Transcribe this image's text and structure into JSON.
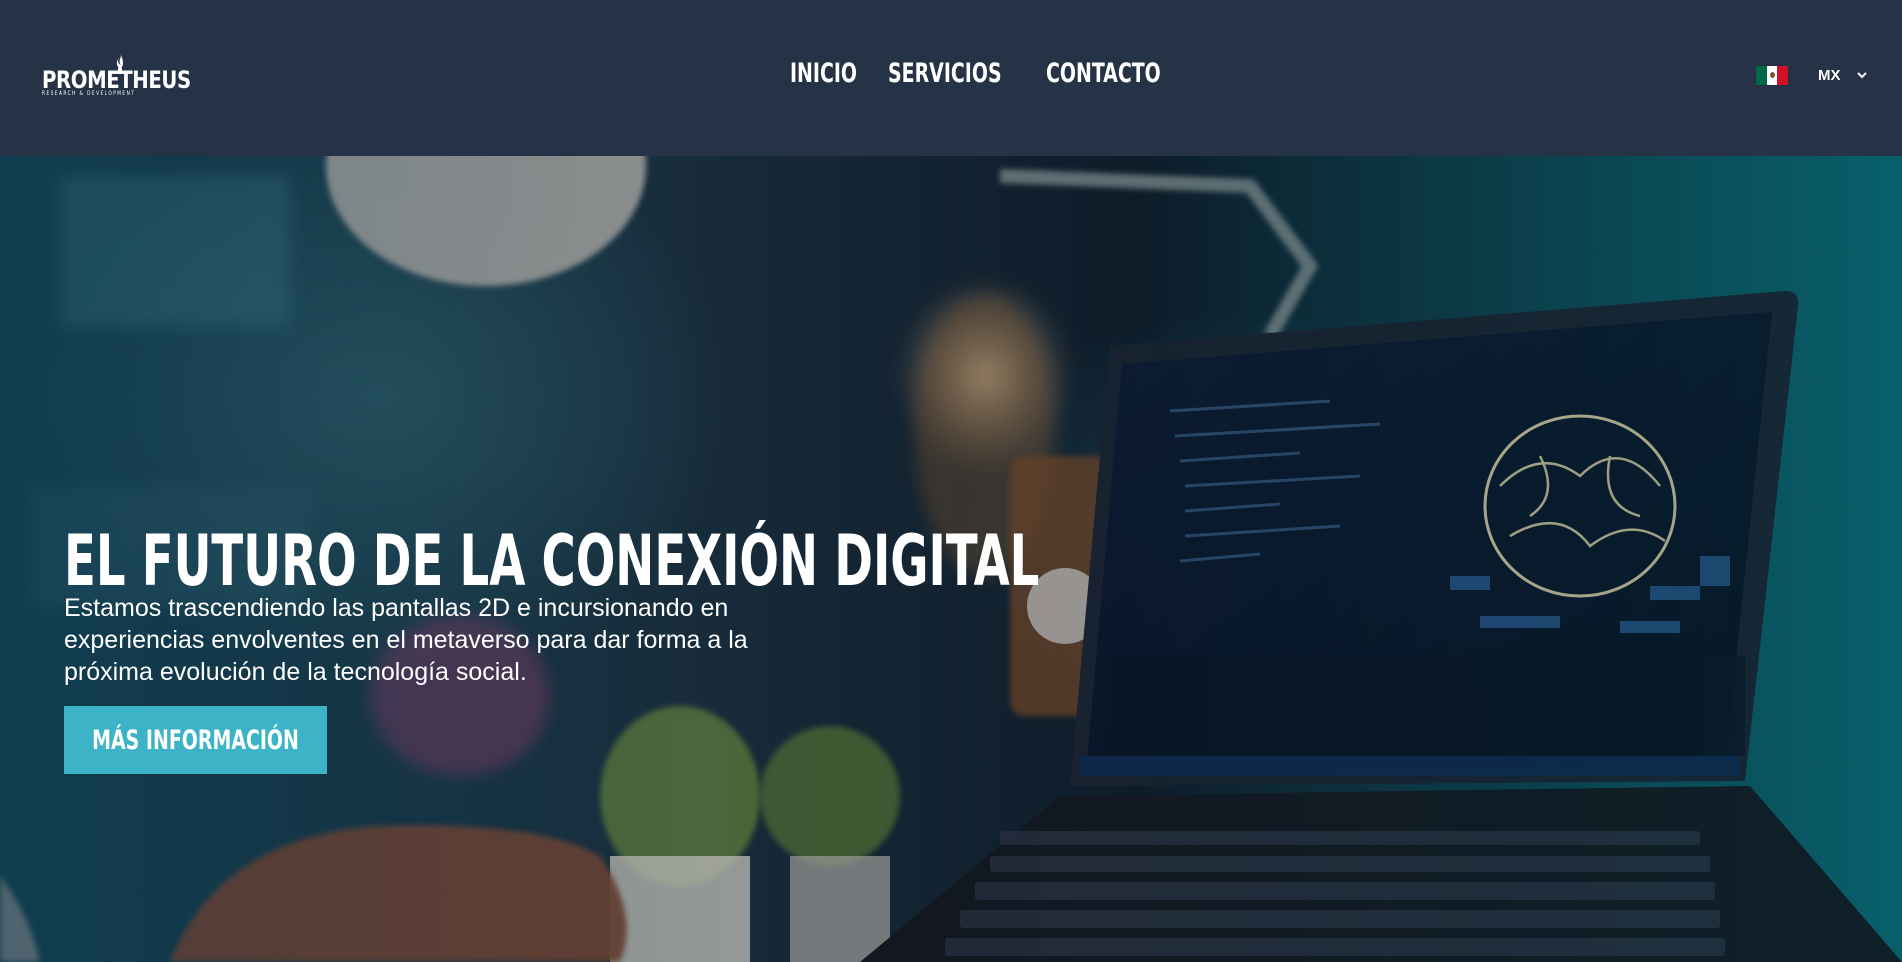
{
  "header": {
    "logo": {
      "name": "PROMETHEUS",
      "tagline": "RESEARCH & DEVELOPMENT"
    },
    "nav": [
      {
        "label": "INICIO"
      },
      {
        "label": "SERVICIOS"
      },
      {
        "label": "CONTACTO"
      }
    ],
    "language": {
      "flag_icon": "mexico-flag-icon",
      "code": "MX"
    }
  },
  "hero": {
    "title": "EL FUTURO DE LA CONEXIÓN DIGITAL",
    "subtitle": "Estamos trascendiendo las pantallas 2D e incursionando en experiencias envolventes en el metaverso para dar forma a la próxima evolución de la tecnología social.",
    "cta_label": "MÁS INFORMACIÓN",
    "background_image": "laptop-ai-brain-photo"
  },
  "colors": {
    "header_bg": "#263245",
    "cta_bg": "#3cb3c6",
    "text": "#ffffff"
  }
}
